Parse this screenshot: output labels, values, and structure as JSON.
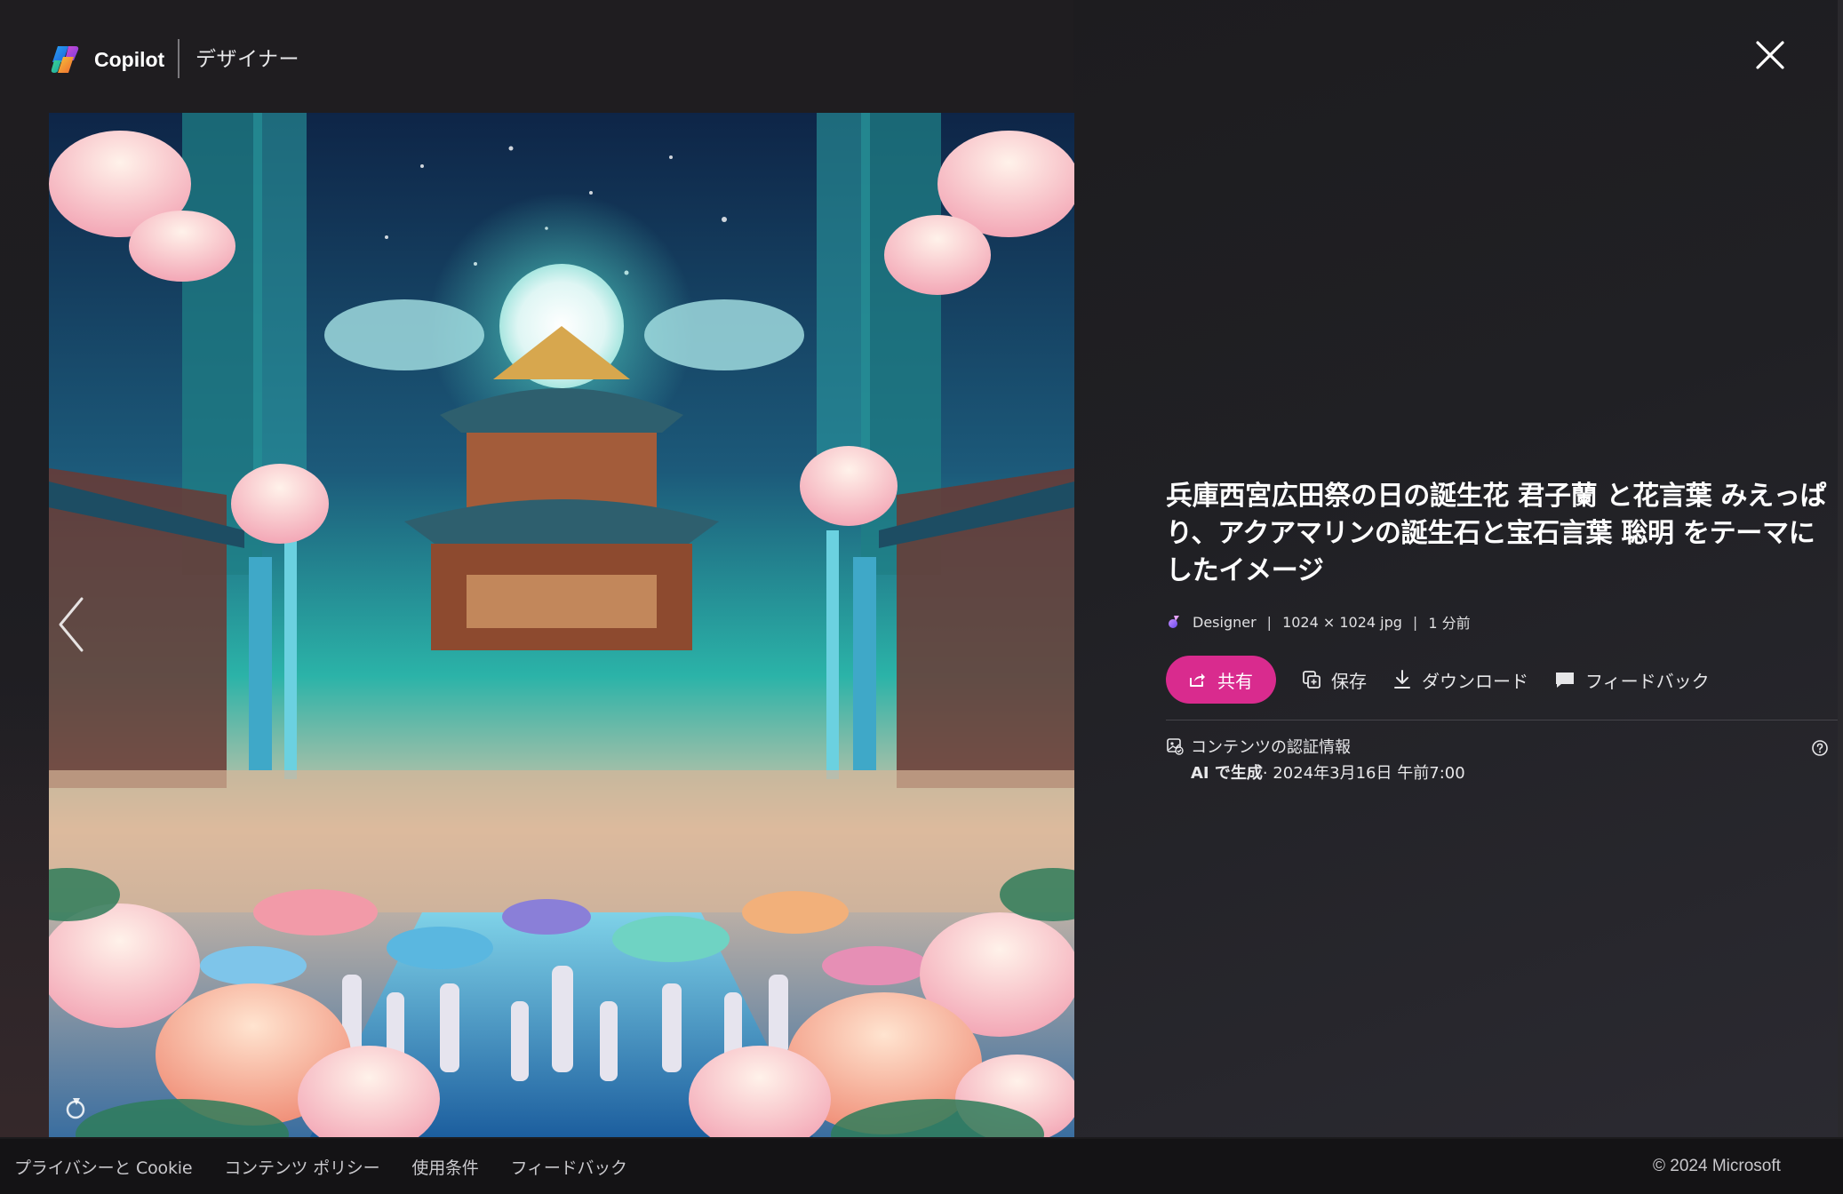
{
  "header": {
    "brand": "Copilot",
    "product": "デザイナー"
  },
  "details": {
    "title": "兵庫西宮広田祭の日の誕生花 君子蘭 と花言葉 みえっぱり、アクアマリンの誕生石と宝石言葉 聡明 をテーマにしたイメージ",
    "meta": {
      "creator": "Designer",
      "sep": "|",
      "resolution": "1024 × 1024 jpg",
      "time_ago": "1 分前"
    },
    "actions": {
      "share": "共有",
      "save": "保存",
      "download": "ダウンロード",
      "feedback": "フィードバック"
    },
    "credentials": {
      "heading": "コンテンツの認証情報",
      "ai_label": "AI で生成",
      "date": " · 2024年3月16日 午前7:00"
    }
  },
  "footer": {
    "links": [
      "プライバシーと Cookie",
      "コンテンツ ポリシー",
      "使用条件",
      "フィードバック"
    ],
    "copyright": "© 2024 Microsoft"
  },
  "colors": {
    "accent": "#d92b8e",
    "background": "#1e1d21",
    "footer": "#141315"
  },
  "icons": [
    "copilot-logo-icon",
    "close-icon",
    "chevron-left-icon",
    "designer-icon",
    "share-icon",
    "save-icon",
    "download-icon",
    "feedback-icon",
    "content-credentials-icon",
    "help-icon"
  ]
}
